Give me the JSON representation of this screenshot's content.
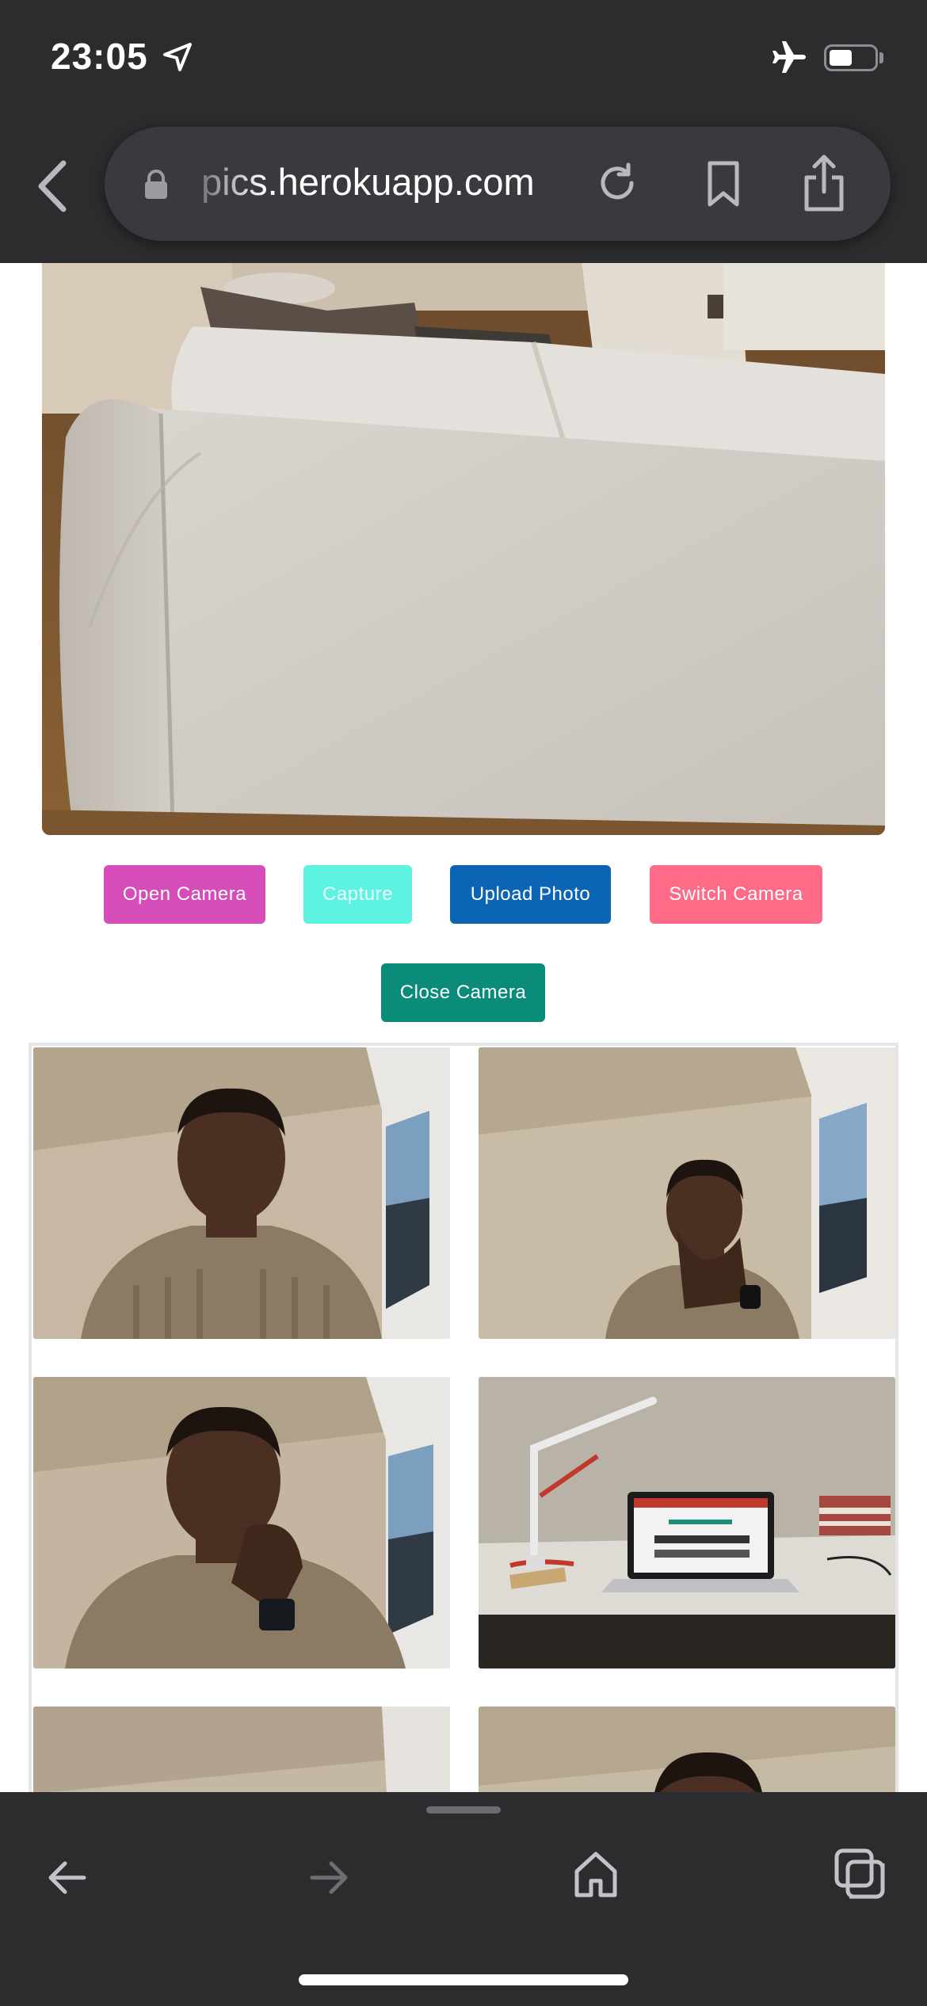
{
  "status_bar": {
    "time": "23:05",
    "icons": [
      "location-arrow-icon",
      "airplane-icon",
      "battery-icon"
    ],
    "battery_level": 0.5
  },
  "browser": {
    "url": "pics.herokuapp.com",
    "icons": [
      "back-chevron-icon",
      "lock-icon",
      "reload-icon",
      "bookmark-icon",
      "share-icon"
    ]
  },
  "app": {
    "buttons": {
      "open_camera": "Open Camera",
      "capture": "Capture",
      "upload_photo": "Upload Photo",
      "switch_camera": "Switch Camera",
      "close_camera": "Close Camera"
    },
    "colors": {
      "open_camera": "#d64db9",
      "capture": "#5df2e2",
      "upload_photo": "#0c64b4",
      "switch_camera": "#ff6a86",
      "close_camera": "#0b8b7a"
    }
  },
  "bottom_toolbar": {
    "icons": [
      "nav-back-icon",
      "nav-forward-icon",
      "home-icon",
      "tabs-icon"
    ]
  }
}
